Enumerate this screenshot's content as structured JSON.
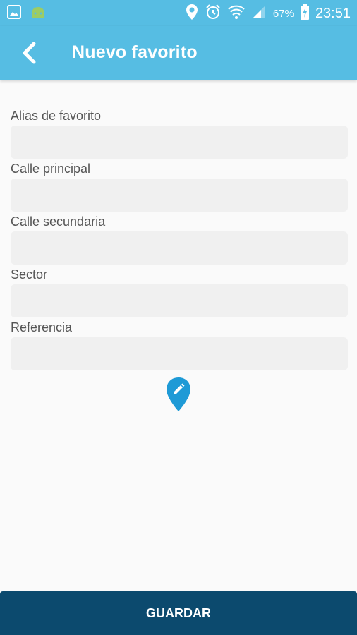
{
  "status_bar": {
    "battery": "67%",
    "time": "23:51",
    "icons": [
      "image-icon",
      "android-icon",
      "location-icon",
      "alarm-icon",
      "wifi-icon",
      "signal-icon",
      "battery-charging-icon"
    ]
  },
  "app_bar": {
    "title": "Nuevo favorito",
    "back_icon": "chevron-left-icon"
  },
  "form": {
    "fields": [
      {
        "label": "Alias de favorito",
        "value": ""
      },
      {
        "label": "Calle principal",
        "value": ""
      },
      {
        "label": "Calle secundaria",
        "value": ""
      },
      {
        "label": "Sector",
        "value": ""
      },
      {
        "label": "Referencia",
        "value": ""
      }
    ]
  },
  "map_pin": {
    "icon": "map-pin-edit-icon",
    "color": "#1e9ad6"
  },
  "footer": {
    "save_label": "GUARDAR"
  },
  "colors": {
    "primary": "#56bde3",
    "save_button": "#0c4a6e",
    "input_bg": "#f0f0f0"
  }
}
